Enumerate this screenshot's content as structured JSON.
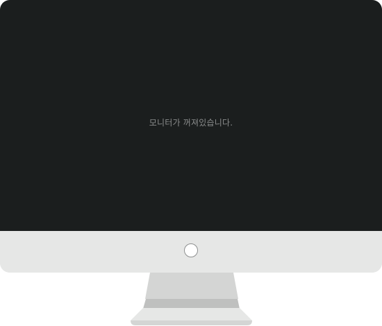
{
  "screen": {
    "message": "모니터가 꺼져있습니다."
  },
  "colors": {
    "screen_background": "#1b1e1e",
    "bezel_chin": "#e6e7e6",
    "message_text": "#8a8c8c",
    "stand": "#d4d5d4",
    "stand_shadow": "#bfc0bf",
    "base": "#e6e7e6"
  },
  "icons": {
    "power": "power-button-circle"
  }
}
